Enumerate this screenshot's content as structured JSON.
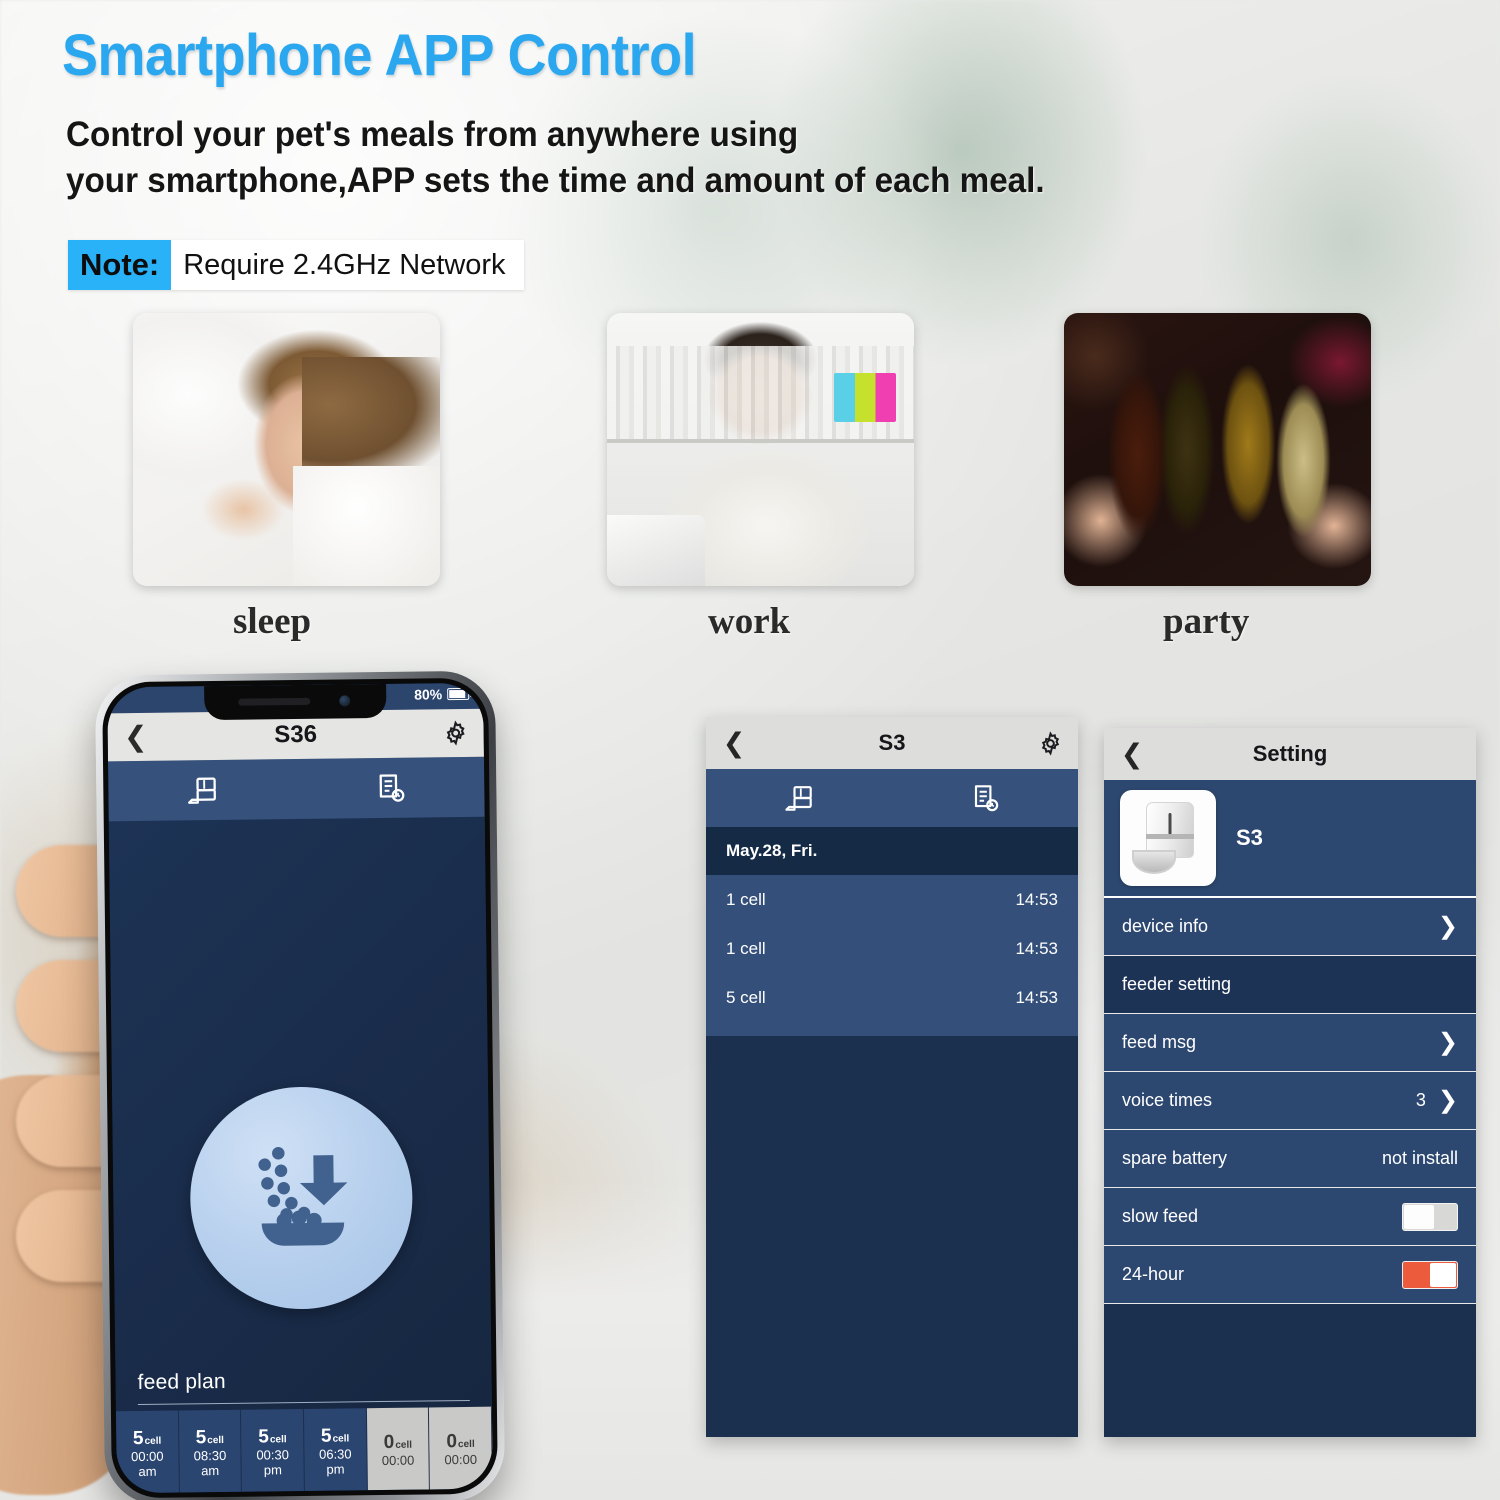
{
  "header": {
    "title": "Smartphone APP Control",
    "subtitle_line1": "Control your pet's meals from anywhere using",
    "subtitle_line2": "your smartphone,APP sets the time and amount of each meal.",
    "note_key": "Note:",
    "note_value": "Require 2.4GHz Network",
    "title_color": "#2ba7f0",
    "note_badge_color": "#29b2f8"
  },
  "scenes": [
    {
      "name": "sleep-photo",
      "caption": "sleep"
    },
    {
      "name": "work-photo",
      "caption": "work"
    },
    {
      "name": "party-photo",
      "caption": "party"
    }
  ],
  "phone": {
    "status": {
      "battery_percent": "80%"
    },
    "appbar": {
      "back_icon": "chevron-left-icon",
      "title": "S36",
      "settings_icon": "gear-icon"
    },
    "tabs": [
      {
        "name": "feeder-tab",
        "icon": "feeder-icon"
      },
      {
        "name": "records-tab",
        "icon": "record-clock-icon"
      }
    ],
    "feed_button_icon": "feed-now-icon",
    "feed_plan_label": "feed plan",
    "plan_cells": [
      {
        "amount": "5",
        "unit": "cell",
        "time": "00:00",
        "meridiem": "am",
        "enabled": true
      },
      {
        "amount": "5",
        "unit": "cell",
        "time": "08:30",
        "meridiem": "am",
        "enabled": true
      },
      {
        "amount": "5",
        "unit": "cell",
        "time": "00:30",
        "meridiem": "pm",
        "enabled": true
      },
      {
        "amount": "5",
        "unit": "cell",
        "time": "06:30",
        "meridiem": "pm",
        "enabled": true
      },
      {
        "amount": "0",
        "unit": "cell",
        "time": "00:00",
        "meridiem": "",
        "enabled": false
      },
      {
        "amount": "0",
        "unit": "cell",
        "time": "00:00",
        "meridiem": "",
        "enabled": false
      }
    ]
  },
  "records_panel": {
    "appbar": {
      "back_icon": "chevron-left-icon",
      "title": "S3",
      "settings_icon": "gear-icon"
    },
    "tabs": [
      {
        "name": "feeder-tab",
        "icon": "feeder-icon"
      },
      {
        "name": "records-tab",
        "icon": "record-clock-icon"
      }
    ],
    "date_header": "May.28,  Fri.",
    "rows": [
      {
        "amount": "1 cell",
        "time": "14:53"
      },
      {
        "amount": "1 cell",
        "time": "14:53"
      },
      {
        "amount": "5 cell",
        "time": "14:53"
      }
    ]
  },
  "settings_panel": {
    "appbar": {
      "back_icon": "chevron-left-icon",
      "title": "Setting"
    },
    "device": {
      "thumb_icon": "pet-feeder-icon",
      "name": "S3"
    },
    "rows": [
      {
        "label": "device info",
        "type": "chevron",
        "value": "",
        "dark": false
      },
      {
        "label": "feeder setting",
        "type": "section",
        "value": "",
        "dark": true
      },
      {
        "label": "feed msg",
        "type": "chevron",
        "value": "",
        "dark": false
      },
      {
        "label": "voice times",
        "type": "value-chevron",
        "value": "3",
        "dark": false
      },
      {
        "label": "spare battery",
        "type": "value",
        "value": "not install",
        "dark": false
      },
      {
        "label": "slow feed",
        "type": "toggle-off",
        "value": "",
        "dark": false
      },
      {
        "label": "24-hour",
        "type": "toggle-on",
        "value": "",
        "dark": false
      }
    ],
    "toggle_on_color": "#ec5b3c",
    "toggle_off_color": "#d8d8d6"
  }
}
